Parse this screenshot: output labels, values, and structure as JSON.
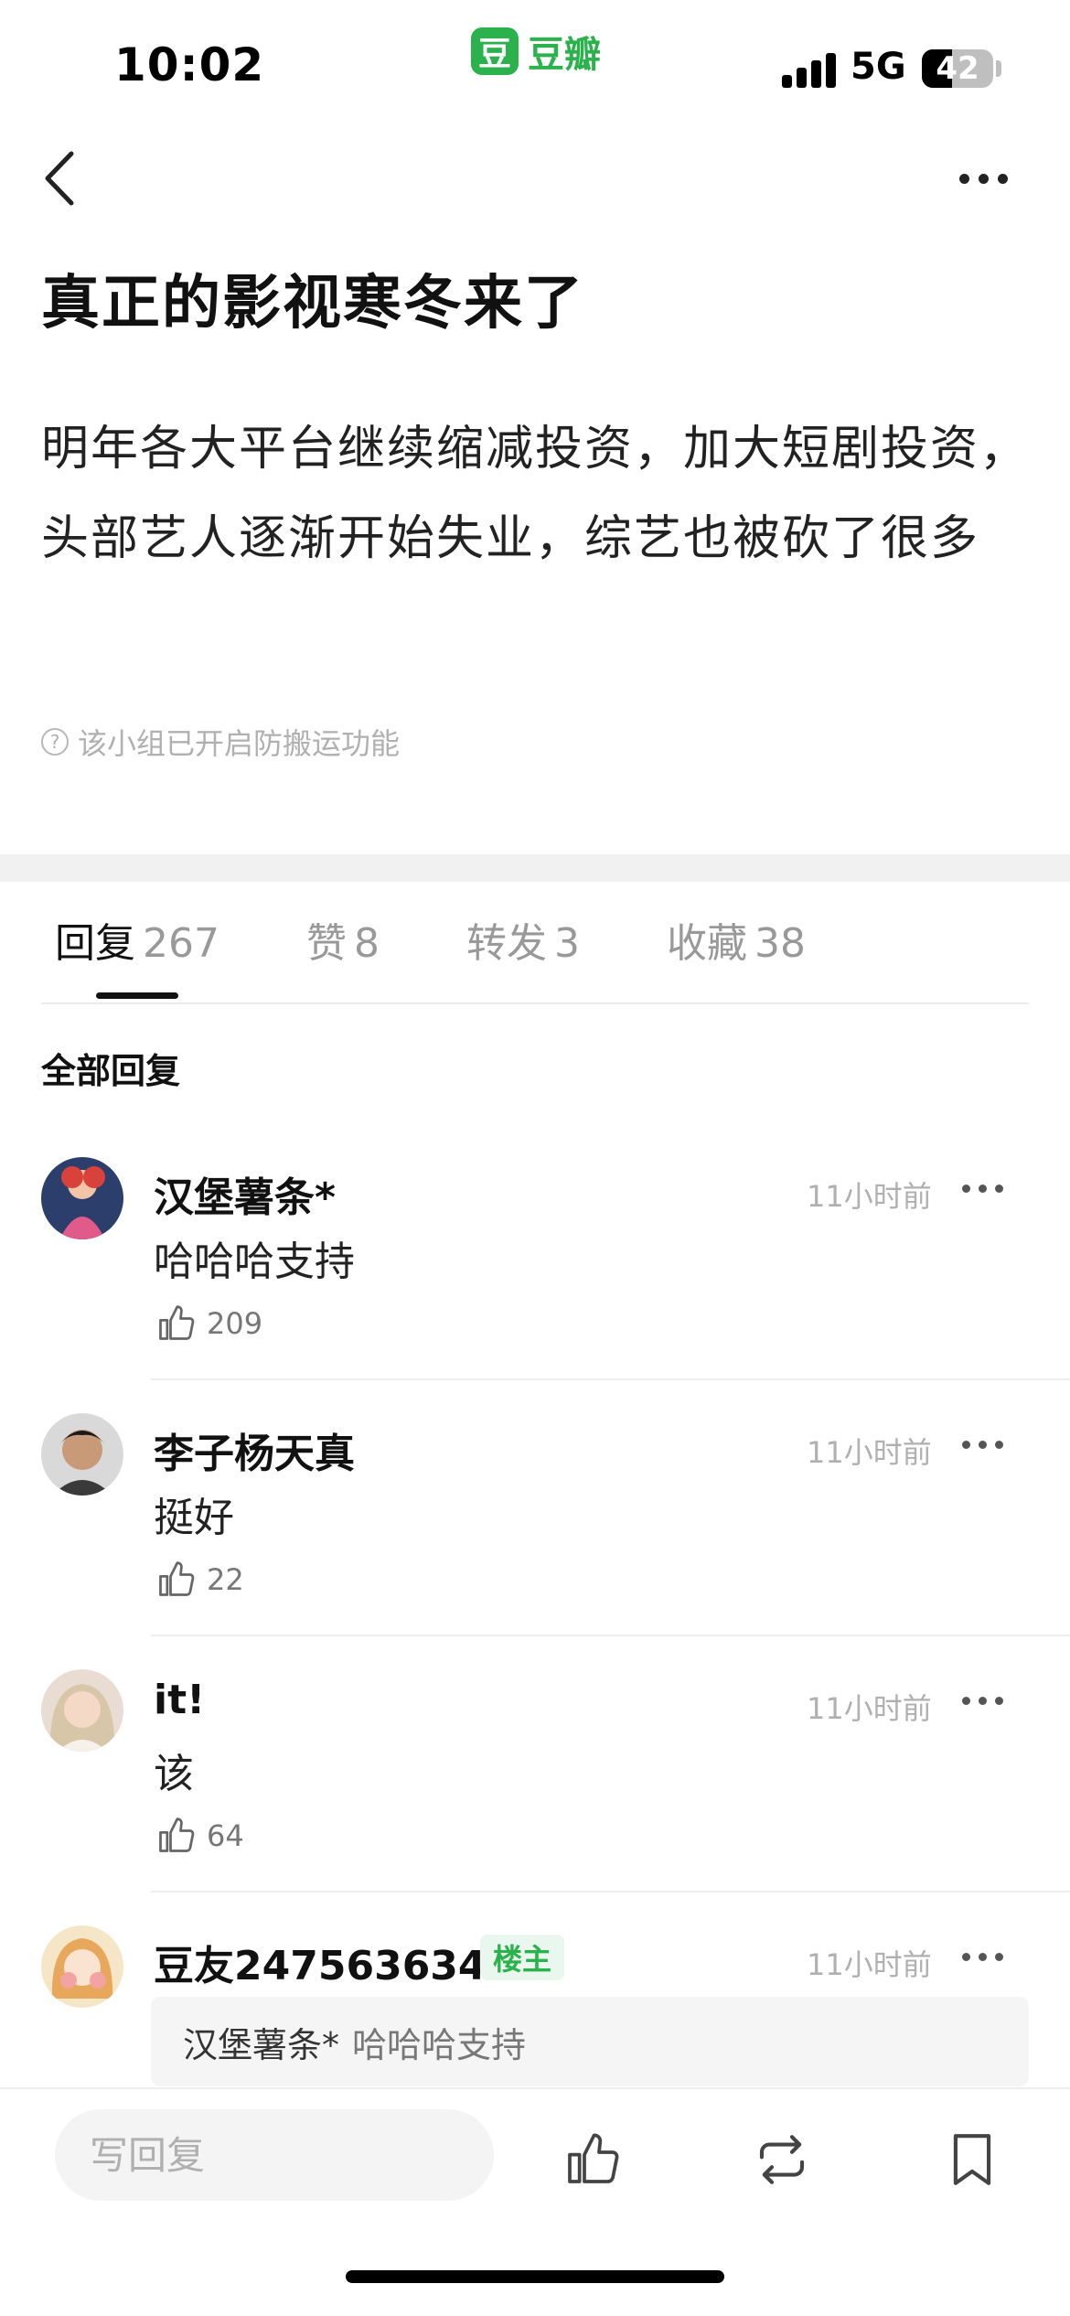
{
  "status_bar": {
    "time": "10:02",
    "network": "5G",
    "battery": "42",
    "battery_level": 0.42
  },
  "app": {
    "logo_char": "豆",
    "name": "豆瓣"
  },
  "post": {
    "title": "真正的影视寒冬来了",
    "body": "明年各大平台继续缩减投资，加大短剧投资，头部艺人逐渐开始失业，综艺也被砍了很多",
    "notice": "该小组已开启防搬运功能",
    "notice_icon": "question-circle-icon"
  },
  "tabs": [
    {
      "label": "回复",
      "count": "267",
      "active": true
    },
    {
      "label": "赞",
      "count": "8",
      "active": false
    },
    {
      "label": "转发",
      "count": "3",
      "active": false
    },
    {
      "label": "收藏",
      "count": "38",
      "active": false
    }
  ],
  "section_title": "全部回复",
  "comments": [
    {
      "name": "汉堡薯条*",
      "time": "11小时前",
      "text": "哈哈哈支持",
      "likes": "209"
    },
    {
      "name": "李子杨天真",
      "time": "11小时前",
      "text": "挺好",
      "likes": "22"
    },
    {
      "name": "it!",
      "time": "11小时前",
      "text": "该",
      "likes": "64"
    },
    {
      "name": "豆友247563634",
      "time": "11小时前",
      "badge": "楼主",
      "quote_author": "汉堡薯条*",
      "quote_text": "哈哈哈支持"
    }
  ],
  "bottom_bar": {
    "reply_placeholder": "写回复",
    "icons": [
      "thumbs-up-icon",
      "repost-icon",
      "bookmark-icon"
    ]
  },
  "colors": {
    "accent": "#2bb24c",
    "muted": "#b0b0b0"
  }
}
